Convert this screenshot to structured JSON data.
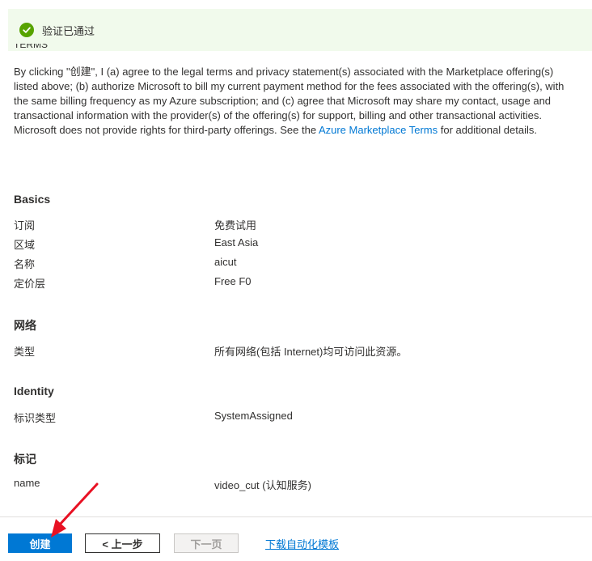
{
  "banner": {
    "text": "验证已通过"
  },
  "terms": {
    "heading_cut": "TERMS",
    "before_link": "By clicking \"创建\", I (a) agree to the legal terms and privacy statement(s) associated with the Marketplace offering(s) listed above; (b) authorize Microsoft to bill my current payment method for the fees associated with the offering(s), with the same billing frequency as my Azure subscription; and (c) agree that Microsoft may share my contact, usage and transactional information with the provider(s) of the offering(s) for support, billing and other transactional activities. Microsoft does not provide rights for third-party offerings. See the ",
    "link": "Azure Marketplace Terms",
    "after_link": " for additional details."
  },
  "basics": {
    "title": "Basics",
    "rows": [
      {
        "key": "订阅",
        "value": "免费试用"
      },
      {
        "key": "区域",
        "value": "East Asia"
      },
      {
        "key": "名称",
        "value": "aicut"
      },
      {
        "key": "定价层",
        "value": "Free F0"
      }
    ]
  },
  "network": {
    "title": "网络",
    "rows": [
      {
        "key": "类型",
        "value": "所有网络(包括 Internet)均可访问此资源。"
      }
    ]
  },
  "identity": {
    "title": "Identity",
    "rows": [
      {
        "key": "标识类型",
        "value": "SystemAssigned"
      }
    ]
  },
  "tags": {
    "title": "标记",
    "rows": [
      {
        "key": "name",
        "value": "video_cut (认知服务)"
      }
    ]
  },
  "footer": {
    "create": "创建",
    "prev": "< 上一步",
    "next": "下一页",
    "download": "下载自动化模板"
  },
  "colors": {
    "accent": "#0078d4",
    "success": "#57a300",
    "annotation_arrow": "#e81123"
  },
  "icons": {
    "banner": "check-circle-icon",
    "annotation": "red-arrow-icon"
  }
}
